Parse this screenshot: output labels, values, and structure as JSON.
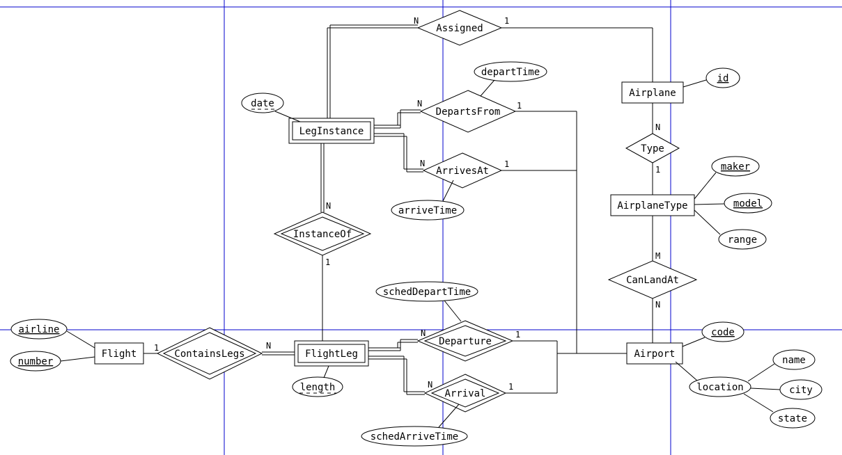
{
  "diagram_type": "ER-diagram",
  "entities": {
    "Flight": {
      "label": "Flight",
      "weak": false
    },
    "FlightLeg": {
      "label": "FlightLeg",
      "weak": true
    },
    "LegInstance": {
      "label": "LegInstance",
      "weak": true
    },
    "Airplane": {
      "label": "Airplane",
      "weak": false
    },
    "AirplaneType": {
      "label": "AirplaneType",
      "weak": false
    },
    "Airport": {
      "label": "Airport",
      "weak": false
    }
  },
  "relationships": {
    "ContainsLegs": {
      "label": "ContainsLegs",
      "identifying": true,
      "card_left": "1",
      "card_right": "N"
    },
    "InstanceOf": {
      "label": "InstanceOf",
      "identifying": true,
      "card_top": "N",
      "card_bottom": "1"
    },
    "Assigned": {
      "label": "Assigned",
      "identifying": false,
      "card_left": "N",
      "card_right": "1"
    },
    "DepartsFrom": {
      "label": "DepartsFrom",
      "identifying": false,
      "card_left": "N",
      "card_right": "1"
    },
    "ArrivesAt": {
      "label": "ArrivesAt",
      "identifying": false,
      "card_left": "N",
      "card_right": "1"
    },
    "Departure": {
      "label": "Departure",
      "identifying": true,
      "card_left": "N",
      "card_right": "1"
    },
    "Arrival": {
      "label": "Arrival",
      "identifying": true,
      "card_left": "N",
      "card_right": "1"
    },
    "Type": {
      "label": "Type",
      "identifying": false,
      "card_top": "N",
      "card_bottom": "1"
    },
    "CanLandAt": {
      "label": "CanLandAt",
      "identifying": false,
      "card_top": "M",
      "card_bottom": "N"
    }
  },
  "attributes": {
    "airline": {
      "label": "airline",
      "key": true,
      "partial": false
    },
    "number": {
      "label": "number",
      "key": true,
      "partial": false
    },
    "length": {
      "label": "length",
      "key": false,
      "partial": true
    },
    "date": {
      "label": "date",
      "key": false,
      "partial": true
    },
    "departTime": {
      "label": "departTime",
      "key": false,
      "partial": false
    },
    "arriveTime": {
      "label": "arriveTime",
      "key": false,
      "partial": false
    },
    "schedDepartTime": {
      "label": "schedDepartTime",
      "key": false,
      "partial": false
    },
    "schedArriveTime": {
      "label": "schedArriveTime",
      "key": false,
      "partial": false
    },
    "id": {
      "label": "id",
      "key": true,
      "partial": false
    },
    "maker": {
      "label": "maker",
      "key": true,
      "partial": false
    },
    "model": {
      "label": "model",
      "key": true,
      "partial": false
    },
    "range": {
      "label": "range",
      "key": false,
      "partial": false
    },
    "code": {
      "label": "code",
      "key": true,
      "partial": false
    },
    "name": {
      "label": "name",
      "key": false,
      "partial": false
    },
    "city": {
      "label": "city",
      "key": false,
      "partial": false
    },
    "state": {
      "label": "state",
      "key": false,
      "partial": false
    },
    "location": {
      "label": "location",
      "key": false,
      "partial": false,
      "composite": true
    }
  },
  "cardinality_tokens": {
    "one": "1",
    "many": "N",
    "many_alt": "M"
  }
}
